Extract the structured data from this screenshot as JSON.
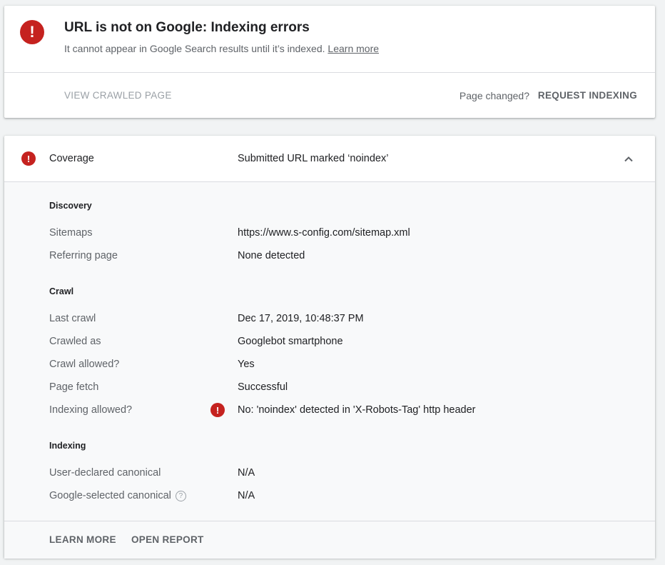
{
  "status": {
    "headline": "URL is not on Google: Indexing errors",
    "subline": "It cannot appear in Google Search results until it’s indexed.",
    "learn_more_link": "Learn more",
    "icon": "error-icon"
  },
  "actions": {
    "view_crawled_page": "VIEW CRAWLED PAGE",
    "page_changed": "Page changed?",
    "request_indexing": "REQUEST INDEXING"
  },
  "coverage": {
    "title": "Coverage",
    "status": "Submitted URL marked ‘noindex’",
    "sections": {
      "discovery": {
        "title": "Discovery",
        "sitemaps_label": "Sitemaps",
        "sitemaps_value": "https://www.s-config.com/sitemap.xml",
        "referring_label": "Referring page",
        "referring_value": "None detected"
      },
      "crawl": {
        "title": "Crawl",
        "last_crawl_label": "Last crawl",
        "last_crawl_value": "Dec 17, 2019, 10:48:37 PM",
        "crawled_as_label": "Crawled as",
        "crawled_as_value": "Googlebot smartphone",
        "crawl_allowed_label": "Crawl allowed?",
        "crawl_allowed_value": "Yes",
        "page_fetch_label": "Page fetch",
        "page_fetch_value": "Successful",
        "indexing_allowed_label": "Indexing allowed?",
        "indexing_allowed_value": "No: 'noindex' detected in 'X-Robots-Tag' http header"
      },
      "indexing": {
        "title": "Indexing",
        "user_canonical_label": "User-declared canonical",
        "user_canonical_value": "N/A",
        "google_canonical_label": "Google-selected canonical",
        "google_canonical_value": "N/A"
      }
    },
    "footer": {
      "learn_more": "LEARN MORE",
      "open_report": "OPEN REPORT"
    }
  },
  "colors": {
    "error_red": "#c5221f",
    "text_primary": "#202124",
    "text_secondary": "#5f6368",
    "disabled": "#9aa0a6"
  }
}
